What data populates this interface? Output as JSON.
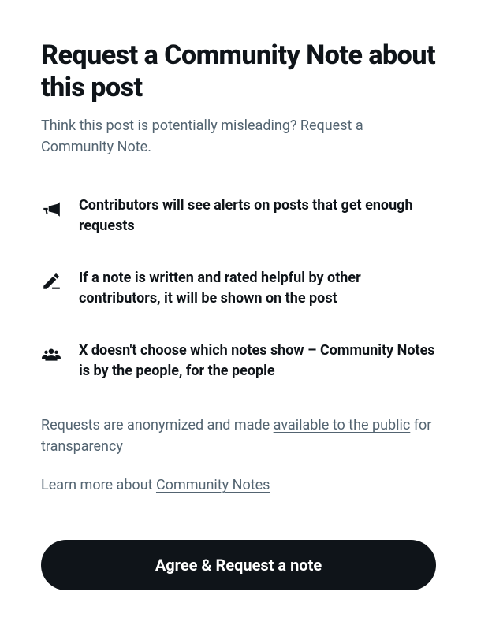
{
  "title": "Request a Community Note about this post",
  "subtitle": "Think this post is potentially misleading? Request a Community Note.",
  "infoItems": [
    {
      "text": "Contributors will see alerts on posts that get enough requests"
    },
    {
      "text": "If a note is written and rated helpful by other contributors, it will be shown on the post"
    },
    {
      "text": "X doesn't choose which notes show – Community Notes is by the people, for the people"
    }
  ],
  "disclaimer": {
    "prefix": "Requests are anonymized and made ",
    "linkText": "available to the public",
    "suffix": " for transparency"
  },
  "learnMore": {
    "prefix": "Learn more about ",
    "linkText": "Community Notes"
  },
  "primaryButton": "Agree & Request a note"
}
